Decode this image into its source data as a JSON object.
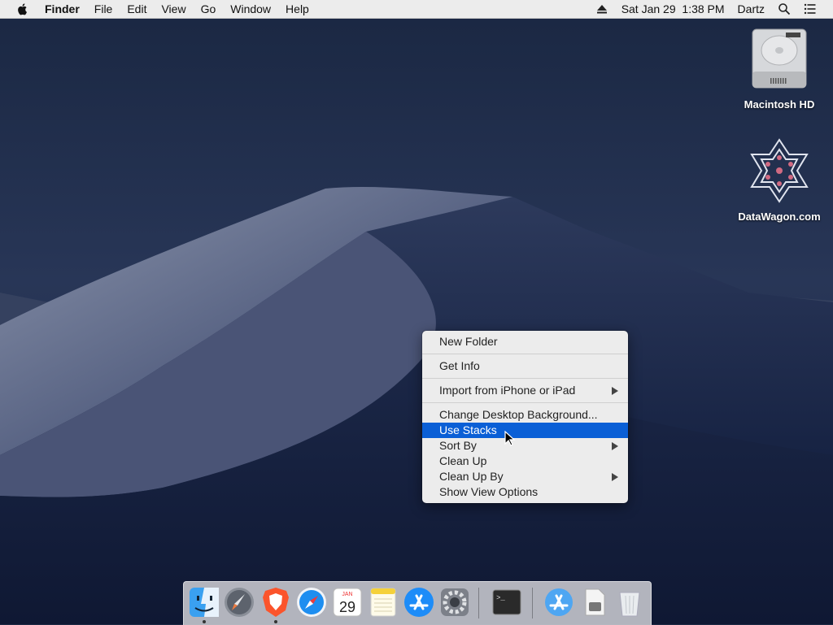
{
  "menubar": {
    "app_name": "Finder",
    "menus": [
      "File",
      "Edit",
      "View",
      "Go",
      "Window",
      "Help"
    ],
    "datetime": "Sat Jan 29  1:38 PM",
    "user": "Dartz",
    "icons": [
      "apple-icon",
      "eject-icon",
      "spotlight-search-icon",
      "notification-center-icon"
    ]
  },
  "desktop_icons": [
    {
      "label": "Macintosh HD",
      "icon": "hard-drive-icon"
    },
    {
      "label": "DataWagon.com",
      "icon": "disk-image-icon"
    }
  ],
  "context_menu": {
    "items": [
      {
        "label": "New Folder"
      },
      {
        "label": "Get Info"
      },
      {
        "label": "Import from iPhone or iPad",
        "submenu": true
      },
      {
        "label": "Change Desktop Background..."
      },
      {
        "label": "Use Stacks",
        "highlighted": true
      },
      {
        "label": "Sort By",
        "submenu": true
      },
      {
        "label": "Clean Up"
      },
      {
        "label": "Clean Up By",
        "submenu": true
      },
      {
        "label": "Show View Options"
      }
    ],
    "highlight_color": "#0a5fd6"
  },
  "dock": {
    "apps": [
      {
        "name": "Finder",
        "icon": "finder-icon",
        "running": true
      },
      {
        "name": "Launchpad",
        "icon": "launchpad-icon",
        "running": false
      },
      {
        "name": "Brave",
        "icon": "brave-icon",
        "running": true
      },
      {
        "name": "Safari",
        "icon": "safari-icon",
        "running": false
      },
      {
        "name": "Calendar",
        "icon": "calendar-icon",
        "running": false,
        "month": "JAN",
        "day": "29"
      },
      {
        "name": "Notes",
        "icon": "notes-icon",
        "running": false
      },
      {
        "name": "App Store",
        "icon": "app-store-icon",
        "running": false
      },
      {
        "name": "System Preferences",
        "icon": "system-preferences-icon",
        "running": false
      },
      {
        "name": "Terminal",
        "icon": "terminal-icon",
        "running": false
      },
      {
        "name": "Applications",
        "icon": "applications-folder-icon",
        "running": false
      },
      {
        "name": "Downloads",
        "icon": "downloads-stack-icon",
        "running": false
      },
      {
        "name": "Trash",
        "icon": "trash-icon",
        "running": false
      }
    ]
  }
}
